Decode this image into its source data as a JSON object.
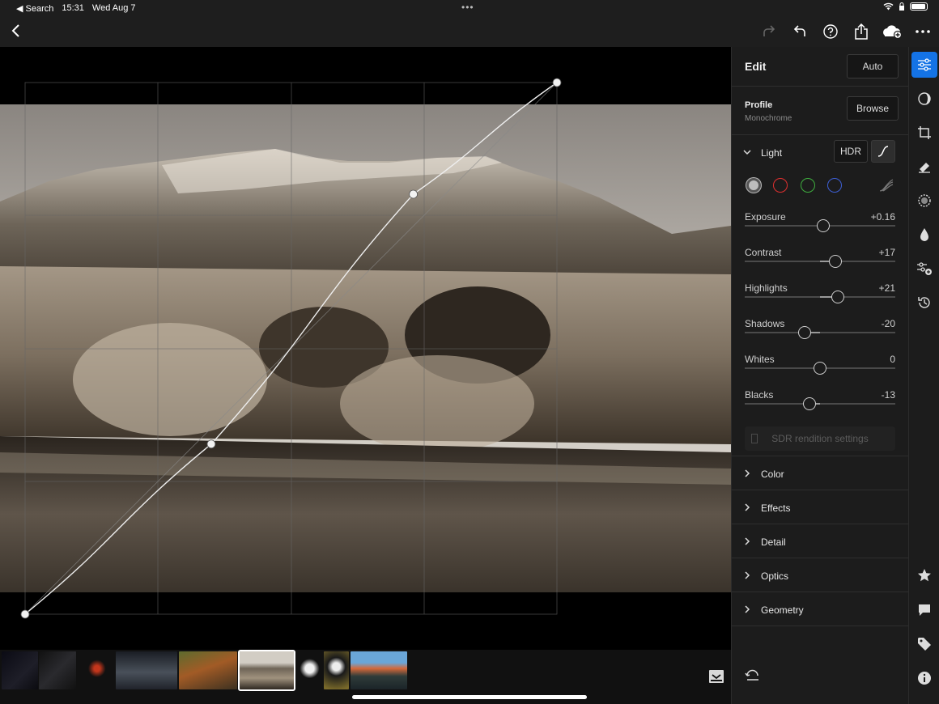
{
  "status_bar": {
    "back_label": "◀ Search",
    "time": "15:31",
    "date": "Wed Aug 7",
    "dots": "•••"
  },
  "toolbar": {
    "icons": [
      "back-icon",
      "redo-icon",
      "undo-icon",
      "help-icon",
      "share-icon",
      "cloud-sync-icon",
      "more-icon"
    ]
  },
  "edit_panel": {
    "title": "Edit",
    "auto_label": "Auto",
    "profile": {
      "label": "Profile",
      "value": "Monochrome",
      "browse_label": "Browse"
    },
    "light": {
      "title": "Light",
      "hdr_label": "HDR",
      "sliders": [
        {
          "name": "Exposure",
          "value": "+0.16",
          "fraction": 0.52
        },
        {
          "name": "Contrast",
          "value": "+17",
          "fraction": 0.6
        },
        {
          "name": "Highlights",
          "value": "+21",
          "fraction": 0.62
        },
        {
          "name": "Shadows",
          "value": "-20",
          "fraction": 0.4
        },
        {
          "name": "Whites",
          "value": "0",
          "fraction": 0.5
        },
        {
          "name": "Blacks",
          "value": "-13",
          "fraction": 0.43
        }
      ],
      "sdr_label": "SDR rendition settings"
    },
    "sections": [
      "Color",
      "Effects",
      "Detail",
      "Optics",
      "Geometry"
    ]
  },
  "tone_curve": {
    "points_input_output": [
      [
        0,
        0
      ],
      [
        0.35,
        0.32
      ],
      [
        0.73,
        0.79
      ],
      [
        1,
        1
      ]
    ]
  },
  "rail_icons": [
    "edit-sliders-icon",
    "masking-icon",
    "crop-icon",
    "healing-icon",
    "selective-icon",
    "blur-icon",
    "presets-icon",
    "versions-icon",
    "rating-star-icon",
    "comment-icon",
    "tag-icon",
    "info-icon"
  ],
  "colors": {
    "accent": "#1473e6",
    "panel_bg": "#1c1c1c",
    "channel_red": "#e03030",
    "channel_green": "#3fae3f",
    "channel_blue": "#3d5fd6"
  }
}
